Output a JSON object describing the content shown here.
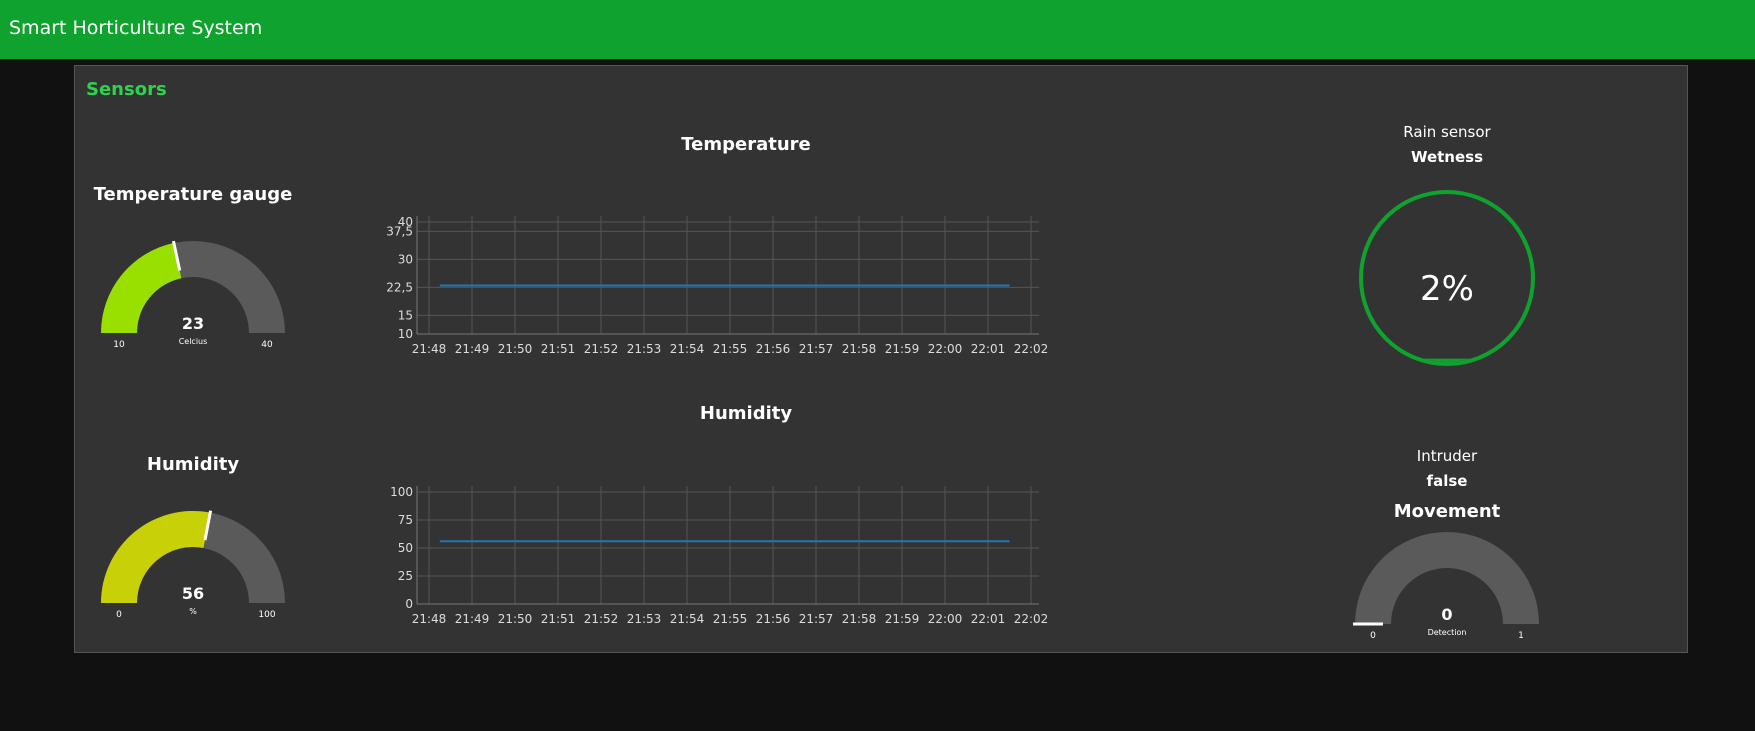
{
  "app": {
    "title": "Smart Horticulture System"
  },
  "theme": {
    "header_bg": "#10a22e",
    "group_title": "#2ed34b",
    "series": "#1f77b4"
  },
  "group": {
    "title": "Sensors"
  },
  "temp_gauge": {
    "title": "Temperature gauge",
    "value": 23,
    "unit": "Celcius",
    "min": 10,
    "max": 40,
    "color": "#99e000"
  },
  "humid_gauge": {
    "title": "Humidity",
    "value": 56,
    "unit": "%",
    "min": 0,
    "max": 100,
    "color": "#c8d008"
  },
  "movement_gauge": {
    "title": "Movement",
    "value": 0,
    "unit": "Detection",
    "min": 0,
    "max": 1
  },
  "rain": {
    "label": "Rain sensor",
    "value": "Wetness",
    "percent": 2,
    "percent_text": "2%"
  },
  "intruder": {
    "label": "Intruder",
    "value": "false"
  },
  "chart_data": [
    {
      "type": "line",
      "title": "Temperature",
      "x": [
        "21:48",
        "21:49",
        "21:50",
        "21:51",
        "21:52",
        "21:53",
        "21:54",
        "21:55",
        "21:56",
        "21:57",
        "21:58",
        "21:59",
        "22:00",
        "22:01",
        "22:02"
      ],
      "yticks": [
        "10",
        "15",
        "22,5",
        "30",
        "37,5",
        "40"
      ],
      "ytick_values": [
        10,
        15,
        22.5,
        30,
        37.5,
        40
      ],
      "ylim": [
        10,
        40
      ],
      "xlim": [
        "21:48",
        "22:02"
      ],
      "grid": true,
      "series": [
        {
          "points": [
            {
              "x": "21:48:15",
              "y": 23
            },
            {
              "x": "22:01:30",
              "y": 23
            }
          ]
        }
      ]
    },
    {
      "type": "line",
      "title": "Humidity",
      "x": [
        "21:48",
        "21:49",
        "21:50",
        "21:51",
        "21:52",
        "21:53",
        "21:54",
        "21:55",
        "21:56",
        "21:57",
        "21:58",
        "21:59",
        "22:00",
        "22:01",
        "22:02"
      ],
      "yticks": [
        "0",
        "25",
        "50",
        "75",
        "100"
      ],
      "ytick_values": [
        0,
        25,
        50,
        75,
        100
      ],
      "ylim": [
        0,
        100
      ],
      "xlim": [
        "21:48",
        "22:02"
      ],
      "grid": true,
      "series": [
        {
          "points": [
            {
              "x": "21:48:15",
              "y": 56
            },
            {
              "x": "22:01:30",
              "y": 56
            }
          ]
        }
      ]
    }
  ]
}
